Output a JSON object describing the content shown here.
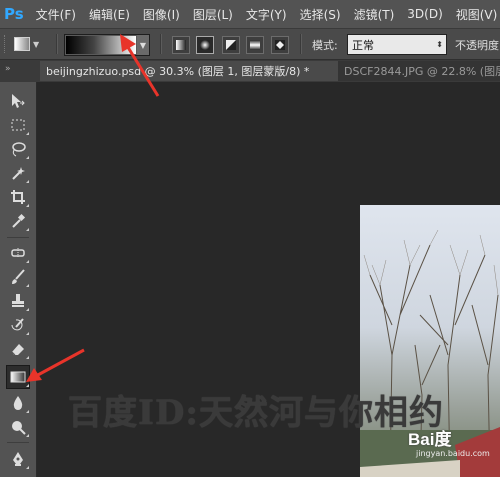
{
  "app": {
    "logo": "Ps"
  },
  "menu": [
    "文件(F)",
    "编辑(E)",
    "图像(I)",
    "图层(L)",
    "文字(Y)",
    "选择(S)",
    "滤镜(T)",
    "3D(D)",
    "视图(V)"
  ],
  "options": {
    "mode_label": "模式:",
    "mode_value": "正常",
    "opacity_label": "不透明度",
    "gradient_types": [
      "linear",
      "radial",
      "angle",
      "reflected",
      "diamond"
    ],
    "active_gradient_type": "radial"
  },
  "tabs": [
    {
      "title": "beijingzhizuo.psd @ 30.3% (图层 1, 图层蒙版/8) *",
      "active": true
    },
    {
      "title": "DSCF2844.JPG @ 22.8% (图层",
      "active": false
    }
  ],
  "tools": [
    "move-icon",
    "marquee-icon",
    "lasso-icon",
    "magic-wand-icon",
    "crop-icon",
    "eyedropper-icon",
    "healing-brush-icon",
    "brush-icon",
    "clone-stamp-icon",
    "history-brush-icon",
    "eraser-icon",
    "gradient-icon",
    "blur-icon",
    "dodge-icon",
    "pen-icon"
  ],
  "active_tool": "gradient-icon",
  "watermark": "百度ID:天然河与你相约",
  "baidu_logo": "Bai度",
  "baidu_sub": "jingyan.baidu.com",
  "colors": {
    "arrow": "#e8342a",
    "ps_blue": "#31a8ff"
  }
}
